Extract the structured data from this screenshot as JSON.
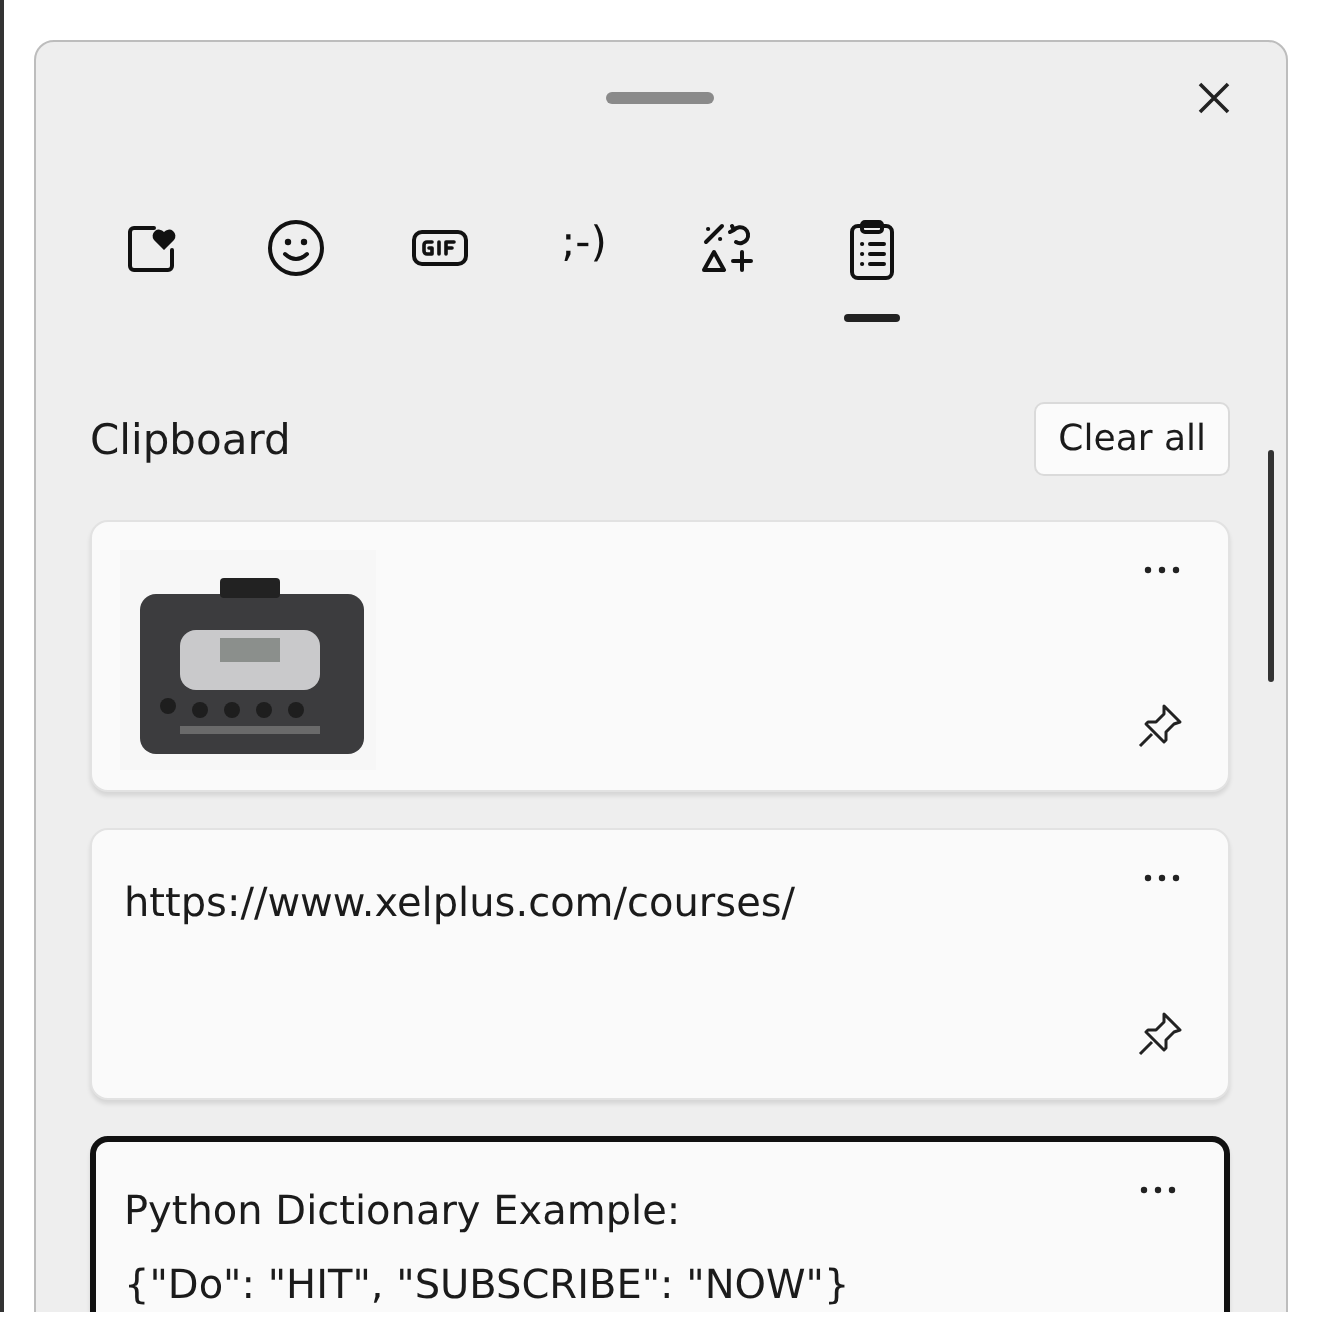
{
  "tabs": [
    {
      "kind": "favorites",
      "selected": false
    },
    {
      "kind": "emoji",
      "selected": false
    },
    {
      "kind": "gif",
      "selected": false
    },
    {
      "kind": "kaomoji",
      "label": ";-)",
      "selected": false
    },
    {
      "kind": "symbols",
      "selected": false
    },
    {
      "kind": "clipboard",
      "selected": true
    }
  ],
  "section": {
    "title": "Clipboard",
    "clear_button": "Clear all"
  },
  "items": [
    {
      "kind": "picture",
      "selected": false,
      "actions": [
        {
          "kind": "more"
        },
        {
          "kind": "pin"
        }
      ]
    },
    {
      "kind": "text",
      "text": "https://www.xelplus.com/courses/",
      "selected": false,
      "actions": [
        {
          "kind": "more"
        },
        {
          "kind": "pin"
        }
      ]
    },
    {
      "kind": "text",
      "text": "Python Dictionary Example:\n{\"Do\": \"HIT\", \"SUBSCRIBE\": \"NOW\"}",
      "selected": true,
      "actions": [
        {
          "kind": "more"
        }
      ]
    }
  ]
}
